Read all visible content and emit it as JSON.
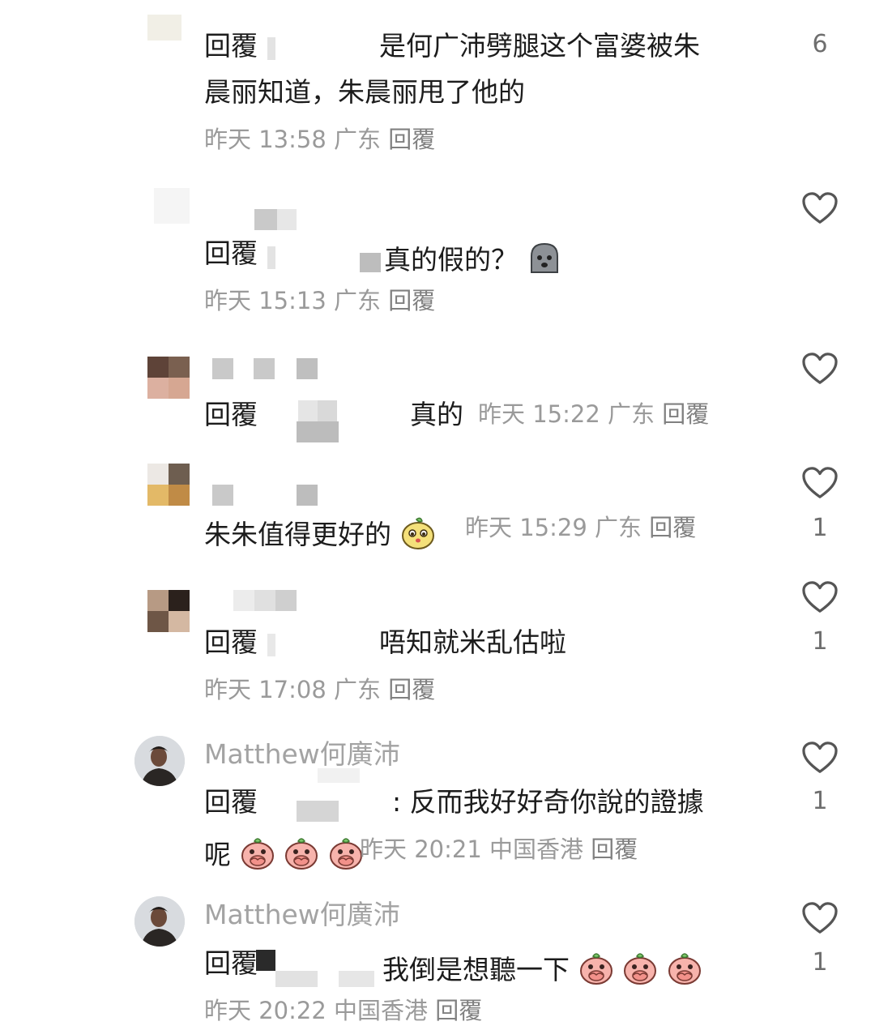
{
  "comments": [
    {
      "reply_prefix": "回覆",
      "text_line1": "是何广沛劈腿这个富婆被朱",
      "text_line2": "晨丽知道，朱晨丽甩了他的",
      "meta": "昨天 13:58 广东",
      "reply_label": "回覆",
      "like_count": "6"
    },
    {
      "reply_prefix": "回覆",
      "text": "真的假的？",
      "meta": "昨天 15:13 广东",
      "reply_label": "回覆"
    },
    {
      "reply_prefix": "回覆",
      "text": "真的",
      "meta": "昨天 15:22 广东",
      "reply_label": "回覆"
    },
    {
      "text": "朱朱值得更好的",
      "meta": "昨天 15:29 广东",
      "reply_label": "回覆",
      "like_count": "1"
    },
    {
      "reply_prefix": "回覆",
      "text": "唔知就米乱估啦",
      "meta": "昨天 17:08 广东",
      "reply_label": "回覆",
      "like_count": "1"
    },
    {
      "username": "Matthew何廣沛",
      "reply_prefix": "回覆",
      "text_line1": ": 反而我好好奇你說的證據",
      "text_line2": "呢",
      "meta": "昨天 20:21 中国香港",
      "reply_label": "回覆",
      "like_count": "1"
    },
    {
      "username": "Matthew何廣沛",
      "reply_prefix": "回覆",
      "text": "我倒是想聽一下",
      "meta": "昨天 20:22 中国香港",
      "reply_label": "回覆",
      "like_count": "1"
    }
  ],
  "icons": {
    "like": "heart-outline-icon",
    "emoji_ghost": "sad-face-emoji",
    "emoji_yellow": "yellow-peach-face-emoji",
    "emoji_pink": "pink-peach-covering-mouth-emoji"
  },
  "colors": {
    "primary_text": "#1c1c1c",
    "meta_text": "#9a9a9a",
    "username_text": "#a3a3a3",
    "icon": "#555555"
  }
}
